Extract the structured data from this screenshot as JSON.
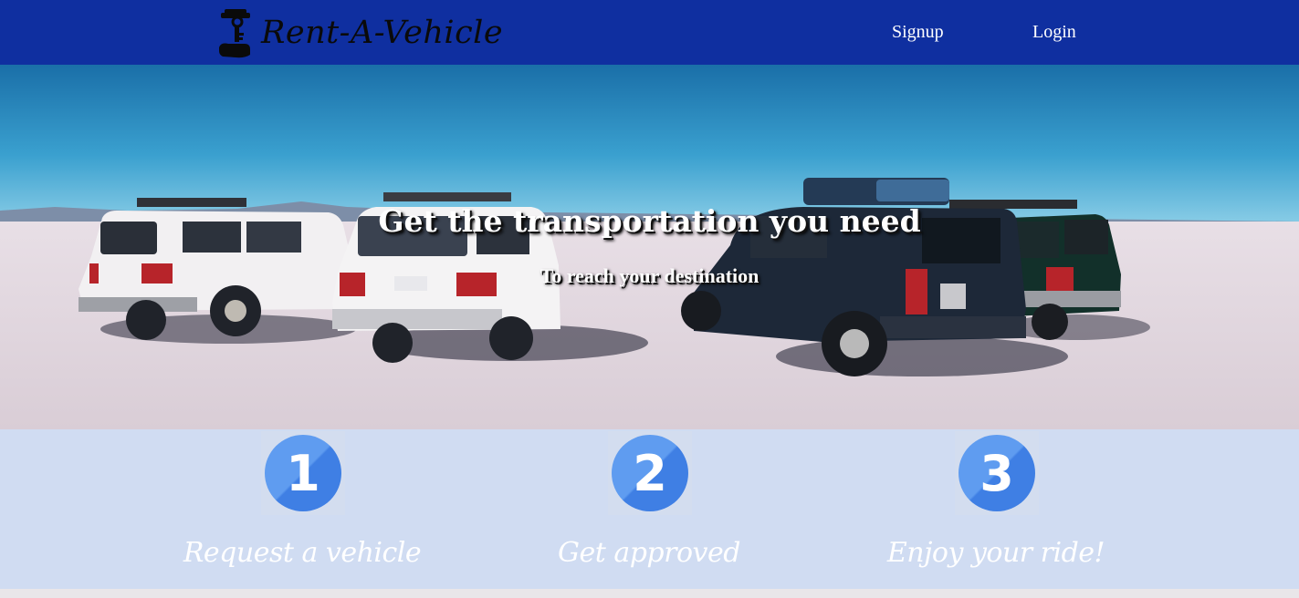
{
  "header": {
    "brand_name": "Rent-A-Vehicle",
    "nav": {
      "signup_label": "Signup",
      "login_label": "Login"
    },
    "colors": {
      "background": "#0f2fa0",
      "text": "#ffffff"
    },
    "logo_icon": "key-in-hand-icon"
  },
  "hero": {
    "title": "Get the transportation you need",
    "subtitle": "To reach your destination",
    "image": "suvs-on-salt-flats"
  },
  "steps": [
    {
      "number": "1",
      "label": "Request a vehicle"
    },
    {
      "number": "2",
      "label": "Get approved"
    },
    {
      "number": "3",
      "label": "Enjoy your ride!"
    }
  ],
  "colors": {
    "steps_background": "#d0dcf2",
    "badge": "#4a8ae8"
  }
}
